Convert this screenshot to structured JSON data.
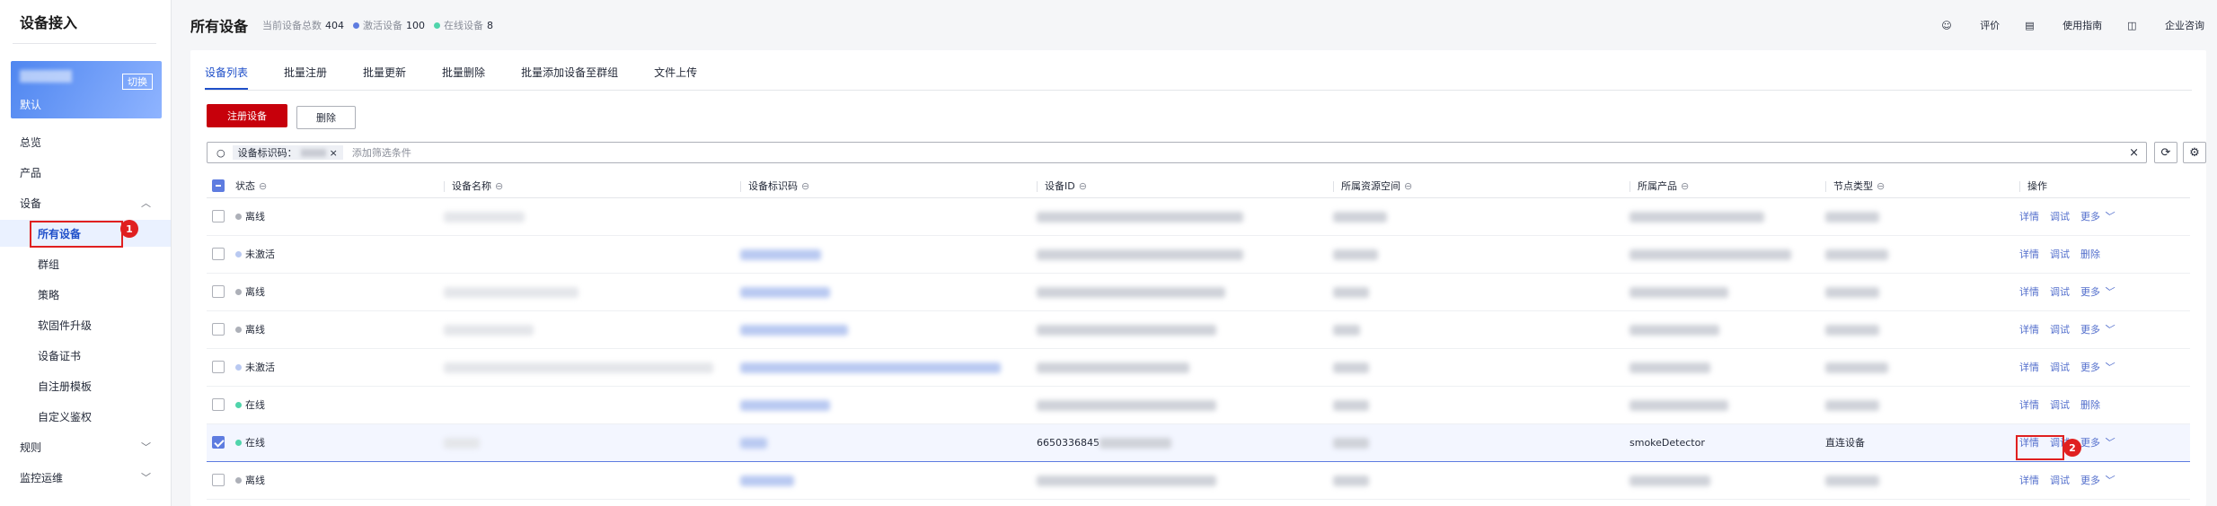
{
  "sidebar": {
    "title": "设备接入",
    "instance_switch": "切换",
    "instance_label": "默认",
    "nav": [
      {
        "label": "总览"
      },
      {
        "label": "产品"
      },
      {
        "label": "设备",
        "chevron": "chevron-up"
      },
      {
        "label": "所有设备",
        "active": true
      },
      {
        "label": "群组"
      },
      {
        "label": "策略"
      },
      {
        "label": "软固件升级"
      },
      {
        "label": "设备证书"
      },
      {
        "label": "自注册模板"
      },
      {
        "label": "自定义鉴权"
      },
      {
        "label": "规则",
        "chevron": "chevron-down"
      },
      {
        "label": "监控运维",
        "chevron": "chevron-down"
      }
    ]
  },
  "annotations": {
    "badge1": "1",
    "badge2": "2",
    "color": "#e02020"
  },
  "header": {
    "title": "所有设备",
    "total_label": "当前设备总数",
    "total_value": "404",
    "activated_label": "激活设备",
    "activated_value": "100",
    "online_label": "在线设备",
    "online_value": "8",
    "activated_color": "#5e7ce0",
    "online_color": "#50d4ab",
    "links": {
      "rate": "评价",
      "guide": "使用指南",
      "consult": "企业咨询"
    }
  },
  "tabs": [
    "设备列表",
    "批量注册",
    "批量更新",
    "批量删除",
    "批量添加设备至群组",
    "文件上传"
  ],
  "toolbar": {
    "register": "注册设备",
    "delete": "删除",
    "primary_color": "#c7000b"
  },
  "search": {
    "chip_label": "设备标识码：",
    "placeholder": "添加筛选条件",
    "clear": "×"
  },
  "table": {
    "columns": [
      "状态",
      "设备名称",
      "设备标识码",
      "设备ID",
      "所属资源空间",
      "所属产品",
      "节点类型",
      "操作"
    ],
    "rows": [
      {
        "status": "离线",
        "status_color": "#adb0b8",
        "actions": [
          "详情",
          "调试",
          "更多"
        ]
      },
      {
        "status": "未激活",
        "status_color": "#b9c9f1",
        "actions": [
          "详情",
          "调试",
          "删除"
        ]
      },
      {
        "status": "离线",
        "status_color": "#adb0b8",
        "actions": [
          "详情",
          "调试",
          "更多"
        ]
      },
      {
        "status": "离线",
        "status_color": "#adb0b8",
        "actions": [
          "详情",
          "调试",
          "更多"
        ]
      },
      {
        "status": "未激活",
        "status_color": "#b9c9f1",
        "actions": [
          "详情",
          "调试",
          "更多"
        ]
      },
      {
        "status": "在线",
        "status_color": "#50d4ab",
        "actions": [
          "详情",
          "调试",
          "删除"
        ]
      },
      {
        "status": "在线",
        "status_color": "#50d4ab",
        "selected": true,
        "device_id_prefix": "6650336845",
        "product": "smokeDetector",
        "node_type": "直连设备",
        "actions": [
          "详情",
          "调试",
          "更多"
        ]
      },
      {
        "status": "离线",
        "status_color": "#adb0b8",
        "actions": [
          "详情",
          "调试",
          "更多"
        ]
      }
    ]
  }
}
